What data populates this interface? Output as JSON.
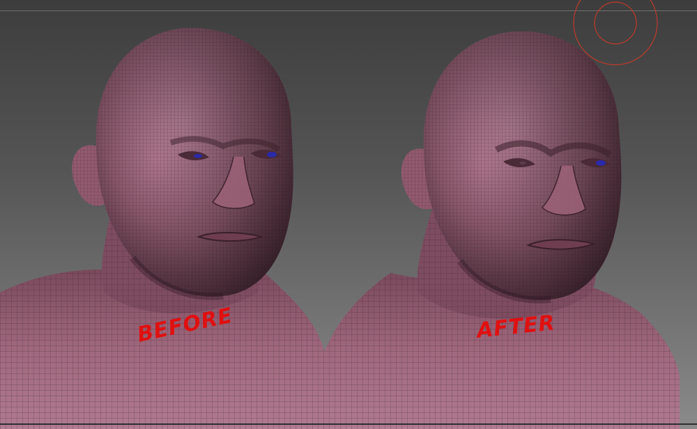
{
  "viewport": {
    "background_top": "#3d3d3d",
    "background_bottom": "#8a8a8a",
    "mesh_color": "#a56f84",
    "wire_color": "#3a2530",
    "iris_color": "#2a2aa8",
    "annotation_color": "#e01010"
  },
  "models": [
    {
      "label": "BEFORE"
    },
    {
      "label": "AFTER"
    }
  ],
  "gizmo": {
    "icon": "transpose-circle-icon",
    "color": "#c0392b"
  }
}
